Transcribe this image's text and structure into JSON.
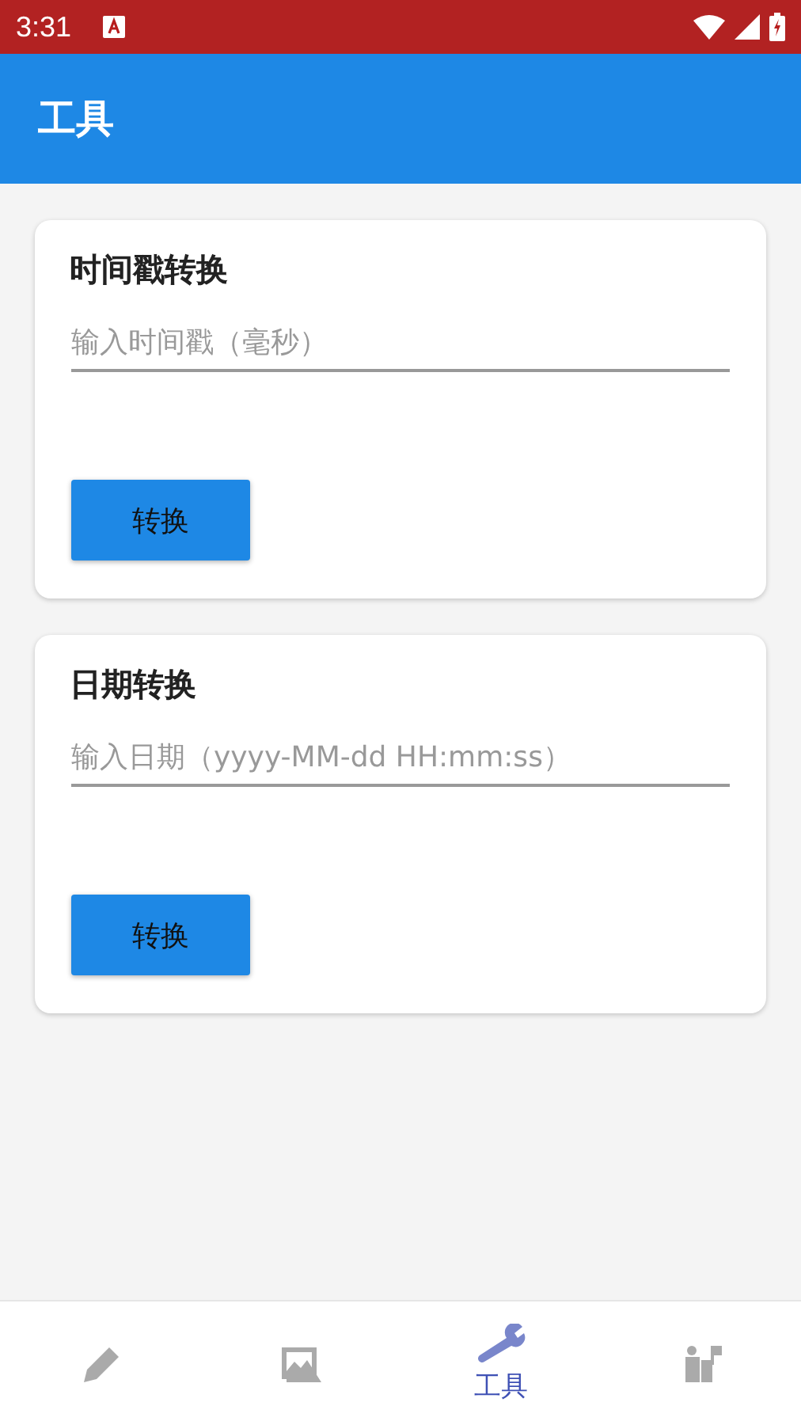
{
  "status_bar": {
    "time": "3:31"
  },
  "app_bar": {
    "title": "工具"
  },
  "cards": [
    {
      "title": "时间戳转换",
      "field": {
        "placeholder": "输入时间戳（毫秒）"
      },
      "button": "转换"
    },
    {
      "title": "日期转换",
      "field": {
        "placeholder": "输入日期（yyyy-MM-dd HH:mm:ss）"
      },
      "button": "转换"
    }
  ],
  "bottom_nav": [
    {
      "kind": "pencil",
      "selected": false
    },
    {
      "kind": "image",
      "selected": false
    },
    {
      "kind": "wrench",
      "selected": true,
      "label": "工具"
    },
    {
      "kind": "people",
      "selected": false
    }
  ]
}
